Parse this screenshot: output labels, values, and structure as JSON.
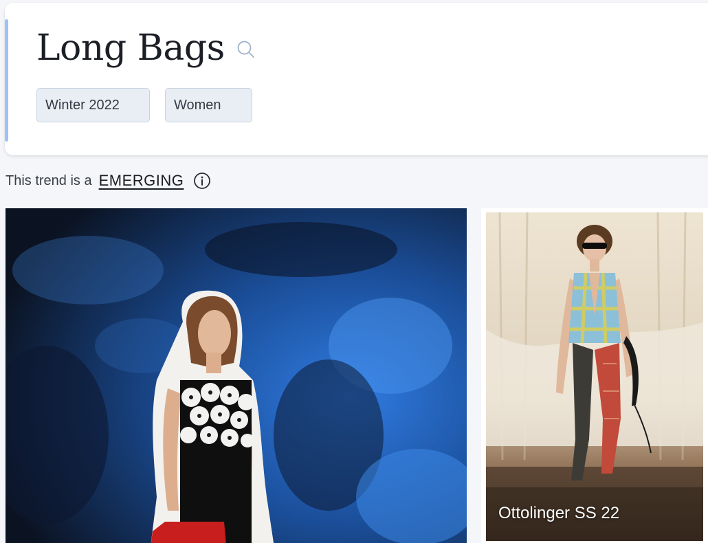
{
  "header": {
    "title": "Long Bags",
    "filters": {
      "season": "Winter 2022",
      "gender": "Women"
    }
  },
  "trend": {
    "prefix": "This trend is a",
    "status": "EMERGING"
  },
  "gallery": {
    "cards": [
      {
        "caption": ""
      },
      {
        "caption": "Ottolinger SS 22"
      }
    ]
  },
  "icons": {
    "search": "search-icon",
    "info": "info-icon"
  },
  "colors": {
    "accent": "#9dc1f7",
    "chip_bg": "#e9eef5",
    "chip_border": "#c8d3e0",
    "page_bg": "#f4f6f9"
  }
}
